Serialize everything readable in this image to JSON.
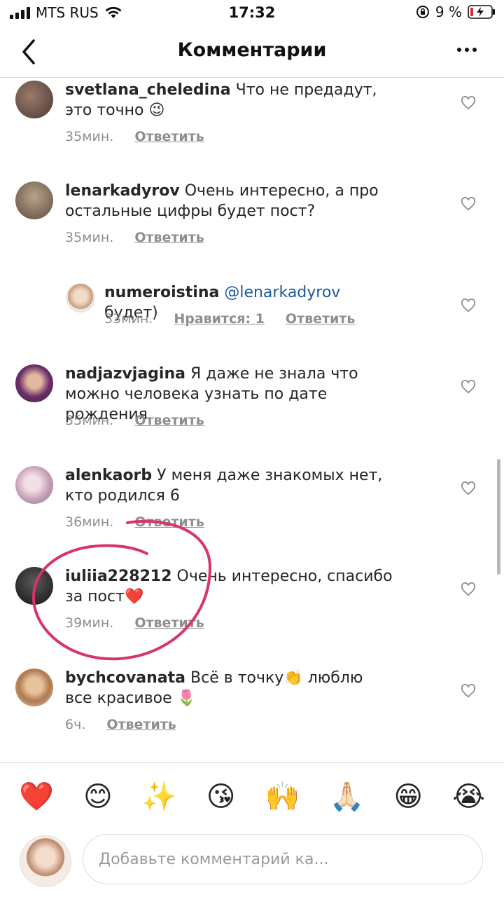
{
  "status_bar": {
    "carrier": "MTS RUS",
    "time": "17:32",
    "battery": "9 %"
  },
  "header": {
    "title": "Комментарии"
  },
  "comments": [
    {
      "username": "svetlana_cheledina",
      "text": "Что не предадут, это точно",
      "emoji": "😉",
      "time": "35мин.",
      "reply": "Ответить"
    },
    {
      "username": "lenarkadyrov",
      "text": "Очень интересно, а про остальные цифры будет пост?",
      "time": "35мин.",
      "reply": "Ответить"
    },
    {
      "username": "numeroistina",
      "mention": "@lenarkadyrov",
      "text": "будет)",
      "time": "33мин.",
      "likes": "Нравится: 1",
      "reply": "Ответить"
    },
    {
      "username": "nadjazvjagina",
      "text": "Я даже не знала что можно человека узнать по дате рождения",
      "time": "35мин.",
      "reply": "Ответить"
    },
    {
      "username": "alenkaorb",
      "text": "У меня даже знакомых нет, кто родился 6",
      "time": "36мин.",
      "reply": "Ответить"
    },
    {
      "username": "iuliia228212",
      "text": "Очень интересно, спасибо за пост",
      "emoji": "❤️",
      "time": "39мин.",
      "reply": "Ответить"
    },
    {
      "username": "bychcovanata",
      "text": "Всё в точку",
      "emoji": "👏",
      "text2": "люблю все красивое",
      "emoji2": "🌷",
      "time": "6ч.",
      "reply": "Ответить"
    }
  ],
  "quick_emojis": [
    "❤️",
    "😊",
    "✨",
    "😘",
    "🙌",
    "🙏🏻",
    "😁",
    "😭"
  ],
  "composer": {
    "placeholder": "Добавьте комментарий ка..."
  },
  "colors": {
    "annotation": "#d8346a",
    "link": "#1a5a9b",
    "meta": "#8e8e8e"
  }
}
